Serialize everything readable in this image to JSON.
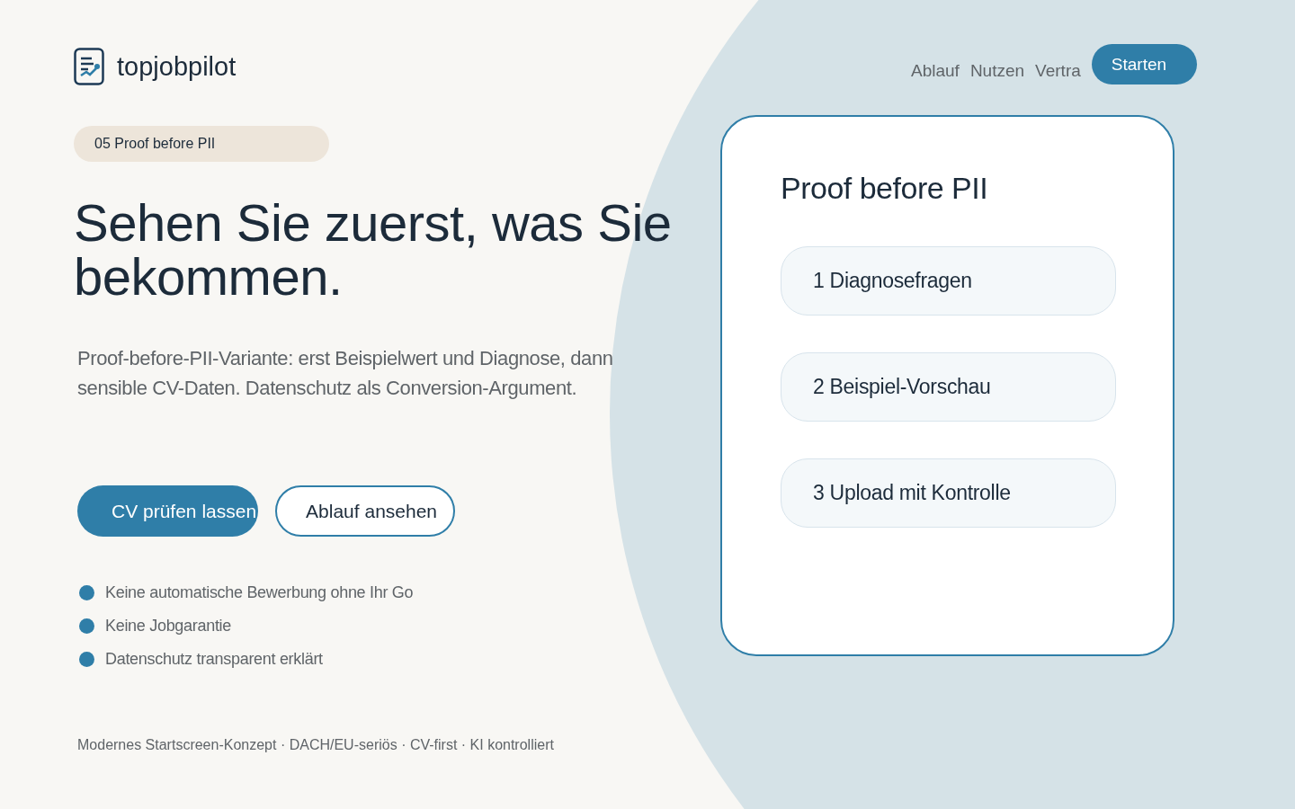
{
  "brand": {
    "name": "topjobpilot"
  },
  "nav": {
    "links": [
      "Ablauf",
      "Nutzen",
      "Vertra"
    ],
    "cta": "Starten"
  },
  "hero": {
    "badge": "05 Proof before PII",
    "title": "Sehen Sie zuerst, was Sie bekommen.",
    "lead": "Proof-before-PII-Variante: erst Beispielwert und Diagnose, dann sensible CV-Daten. Datenschutz als Conversion-Argument.",
    "buttons": [
      {
        "label": "CV prüfen lassen",
        "kind": "primary"
      },
      {
        "label": "Ablauf ansehen",
        "kind": "secondary"
      }
    ],
    "bullets": [
      "Keine automatische Bewerbung ohne Ihr Go",
      "Keine Jobgarantie",
      "Datenschutz transparent erklärt"
    ],
    "footnote": "Modernes Startscreen-Konzept · DACH/EU-seriös · CV-first · KI kontrolliert"
  },
  "card": {
    "title": "Proof before PII",
    "steps": [
      "1 Diagnosefragen",
      "2 Beispiel-Vorschau",
      "3 Upload mit Kontrolle"
    ]
  }
}
